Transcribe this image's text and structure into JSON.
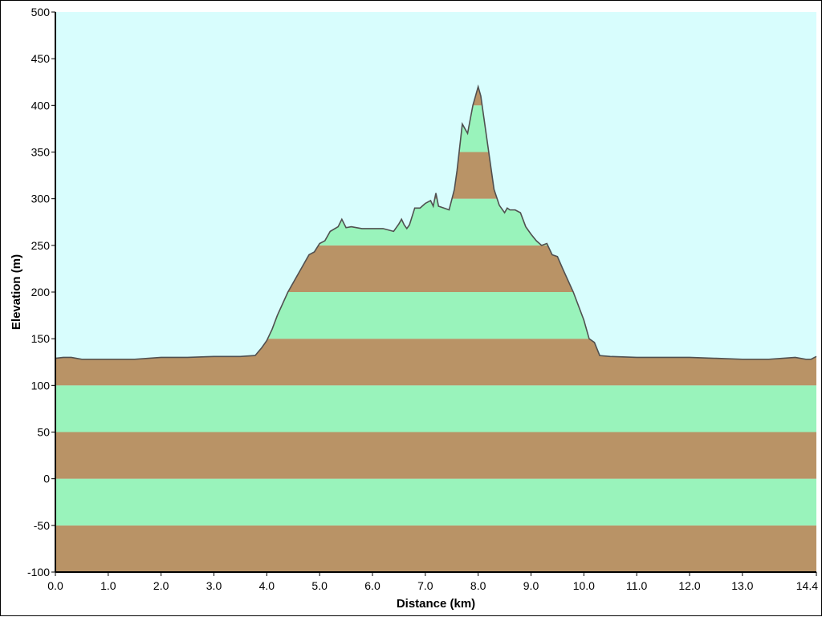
{
  "chart_data": {
    "type": "area",
    "xlabel": "Distance   (km)",
    "ylabel": "Elevation  (m)",
    "xlim": [
      0,
      14.4
    ],
    "ylim": [
      -100,
      500
    ],
    "x_ticks": [
      0,
      1,
      2,
      3,
      4,
      5,
      6,
      7,
      8,
      9,
      10,
      11,
      12,
      13,
      14.4
    ],
    "x_tick_labels": [
      "0.0",
      "1.0",
      "2.0",
      "3.0",
      "4.0",
      "5.0",
      "6.0",
      "7.0",
      "8.0",
      "9.0",
      "10.0",
      "11.0",
      "12.0",
      "13.0",
      "14.4"
    ],
    "y_ticks": [
      -100,
      -50,
      0,
      50,
      100,
      150,
      200,
      250,
      300,
      350,
      400,
      450,
      500
    ],
    "y_tick_labels": [
      "-100",
      "-50",
      "0",
      "50",
      "100",
      "150",
      "200",
      "250",
      "300",
      "350",
      "400",
      "450",
      "500"
    ],
    "band_size": 50,
    "colors": {
      "background": "#d8fdfd",
      "band_brown": "#b99366",
      "band_green": "#99f3bb",
      "profile_line": "#505050",
      "axis": "#000000"
    },
    "grid": false,
    "legend": "none",
    "series": [
      {
        "x": [
          0.0,
          0.15,
          0.3,
          0.5,
          1.0,
          1.5,
          2.0,
          2.5,
          3.0,
          3.5,
          3.78,
          3.9,
          4.0,
          4.1,
          4.2,
          4.4,
          4.6,
          4.8,
          4.9,
          5.0,
          5.1,
          5.2,
          5.35,
          5.42,
          5.5,
          5.6,
          5.8,
          6.0,
          6.2,
          6.4,
          6.5,
          6.55,
          6.6,
          6.65,
          6.7,
          6.8,
          6.9,
          7.0,
          7.1,
          7.15,
          7.2,
          7.25,
          7.35,
          7.45,
          7.55,
          7.6,
          7.7,
          7.75,
          7.8,
          7.85,
          7.9,
          7.95,
          8.0,
          8.05,
          8.1,
          8.2,
          8.3,
          8.4,
          8.5,
          8.55,
          8.6,
          8.7,
          8.8,
          8.9,
          9.0,
          9.1,
          9.2,
          9.3,
          9.4,
          9.5,
          9.6,
          9.8,
          10.0,
          10.1,
          10.2,
          10.3,
          10.5,
          11.0,
          11.5,
          12.0,
          12.5,
          13.0,
          13.5,
          14.0,
          14.2,
          14.3,
          14.4
        ],
        "values": [
          129,
          130,
          130,
          128,
          128,
          128,
          130,
          130,
          131,
          131,
          132,
          140,
          148,
          160,
          175,
          200,
          220,
          240,
          243,
          252,
          255,
          265,
          270,
          278,
          269,
          270,
          268,
          268,
          268,
          265,
          273,
          278,
          272,
          268,
          272,
          290,
          290,
          295,
          298,
          292,
          306,
          292,
          290,
          288,
          310,
          330,
          380,
          375,
          370,
          385,
          400,
          410,
          420,
          410,
          390,
          350,
          310,
          293,
          285,
          290,
          288,
          288,
          285,
          270,
          262,
          255,
          250,
          252,
          240,
          238,
          225,
          200,
          170,
          150,
          146,
          132,
          131,
          130,
          130,
          130,
          129,
          128,
          128,
          130,
          128,
          128,
          131
        ]
      }
    ]
  }
}
